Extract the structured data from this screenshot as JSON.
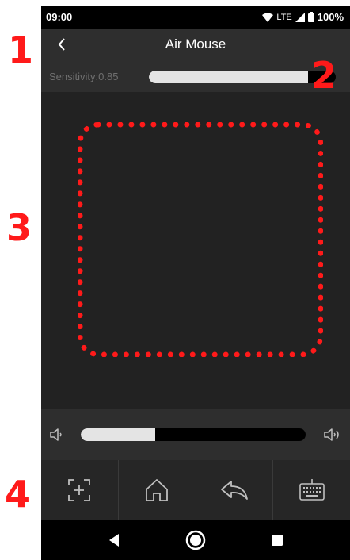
{
  "annotations": [
    "1",
    "2",
    "3",
    "4"
  ],
  "status_bar": {
    "time": "09:00",
    "network": "LTE",
    "battery": "100%",
    "icons": [
      "wifi-icon",
      "signal-icon",
      "battery-icon"
    ]
  },
  "header": {
    "title": "Air Mouse",
    "back_icon": "chevron-left-icon"
  },
  "sensitivity": {
    "label": "Sensitivity:0.85",
    "value": 0.85
  },
  "touchpad": {
    "highlight_color": "#ff1a1a"
  },
  "volume": {
    "level": 0.33,
    "down_icon": "volume-low-icon",
    "up_icon": "volume-high-icon"
  },
  "actions": [
    {
      "name": "screenshot",
      "icon": "capture-plus-icon"
    },
    {
      "name": "home",
      "icon": "home-icon"
    },
    {
      "name": "back",
      "icon": "return-icon"
    },
    {
      "name": "keyboard",
      "icon": "keyboard-icon"
    }
  ],
  "system_nav": [
    "back-triangle-icon",
    "home-circle-icon",
    "recents-square-icon"
  ],
  "colors": {
    "annotation": "#ff1a1a",
    "app_background": "#222222",
    "bar_background": "#2e2e2e",
    "slider_fill": "#e4e4e4",
    "slider_track": "#000000"
  }
}
